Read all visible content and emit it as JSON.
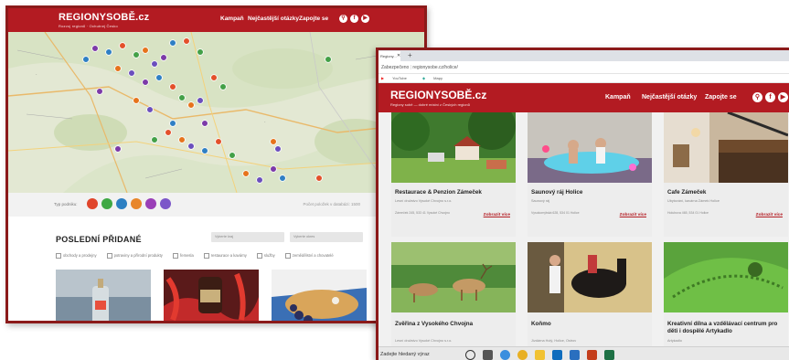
{
  "left_window": {
    "logo": "REGIONYSOBĚ.cz",
    "logo_tagline": "Rozvoj regionů · Ochutnej Česko",
    "nav": [
      "Kampaň",
      "Nejčastější otázky",
      "Zapojte se"
    ],
    "social_icons": [
      "search-icon",
      "facebook-icon",
      "youtube-icon"
    ],
    "legend_label": "Typ podniku:",
    "legend_note": "Počet položek v databázi: 1500",
    "legend_colors": [
      "#e0452b",
      "#3fa844",
      "#2c7fc2",
      "#e8862a",
      "#9a3fb7",
      "#7c57c9"
    ],
    "marker_colors": [
      "#7c3aa8",
      "#2f7fc4",
      "#e3502a",
      "#43a047",
      "#e6731c",
      "#6b4fbd"
    ],
    "section_title": "POSLEDNÍ PŘIDANÉ",
    "select_region": "Vyberte kraj",
    "select_district": "Vyberte okres",
    "filters": [
      "obchody a prodejny",
      "potraviny a přírodní produkty",
      "řemesla",
      "restaurace a kavárny",
      "služby",
      "zemědělství a chovatelé"
    ]
  },
  "right_window": {
    "tab_label": "Regiony...",
    "address": "regionysobe.cz/holice/",
    "address_prefix": "Zabezpečeno",
    "bookmarks": [
      "YouTube",
      "Mapy"
    ],
    "logo": "REGIONYSOBĚ.cz",
    "logo_tagline": "Regiony sobě — dobré místní z Českých regionů",
    "nav": [
      "Kampaň",
      "Nejčastější otázky",
      "Zapojte se"
    ],
    "cards": [
      {
        "title": "Restaurace & Penzion Zámeček",
        "subtitle": "Lesní družstvo Vysoké Chvojno s.r.o.",
        "address": "Zámeček 245, 533 41 Vysoké Chvojno",
        "more": "Zobrazit více"
      },
      {
        "title": "Saunový ráj Holice",
        "subtitle": "Saunový ráj",
        "address": "Vysokomýtská 628, 534 01 Holice",
        "more": "Zobrazit více"
      },
      {
        "title": "Cafe Zámeček",
        "subtitle": "Ubytování, kavárna Zámek Holice",
        "address": "Holubova 465, 534 01 Holice",
        "more": "Zobrazit více"
      },
      {
        "title": "Zvěřina z Vysokého Chvojna",
        "subtitle": "Lesní družstvo Vysoké Chvojno s.r.o.",
        "address": "Vysoké Chvojno 245, 533 41",
        "more": "Zobrazit více"
      },
      {
        "title": "Koňmo",
        "subtitle": "Jízdárna Holý, Holice, Ostrov",
        "address": "Ostrov 22, 534 01 Holice",
        "more": "Zobrazit více"
      },
      {
        "title": "Kreativní dílna a vzdělávací centrum pro děti i dospělé Artykadlo",
        "subtitle": "Artykadlo",
        "address": "",
        "more": ""
      }
    ],
    "taskbar_search": "Zadejte hledaný výraz"
  }
}
